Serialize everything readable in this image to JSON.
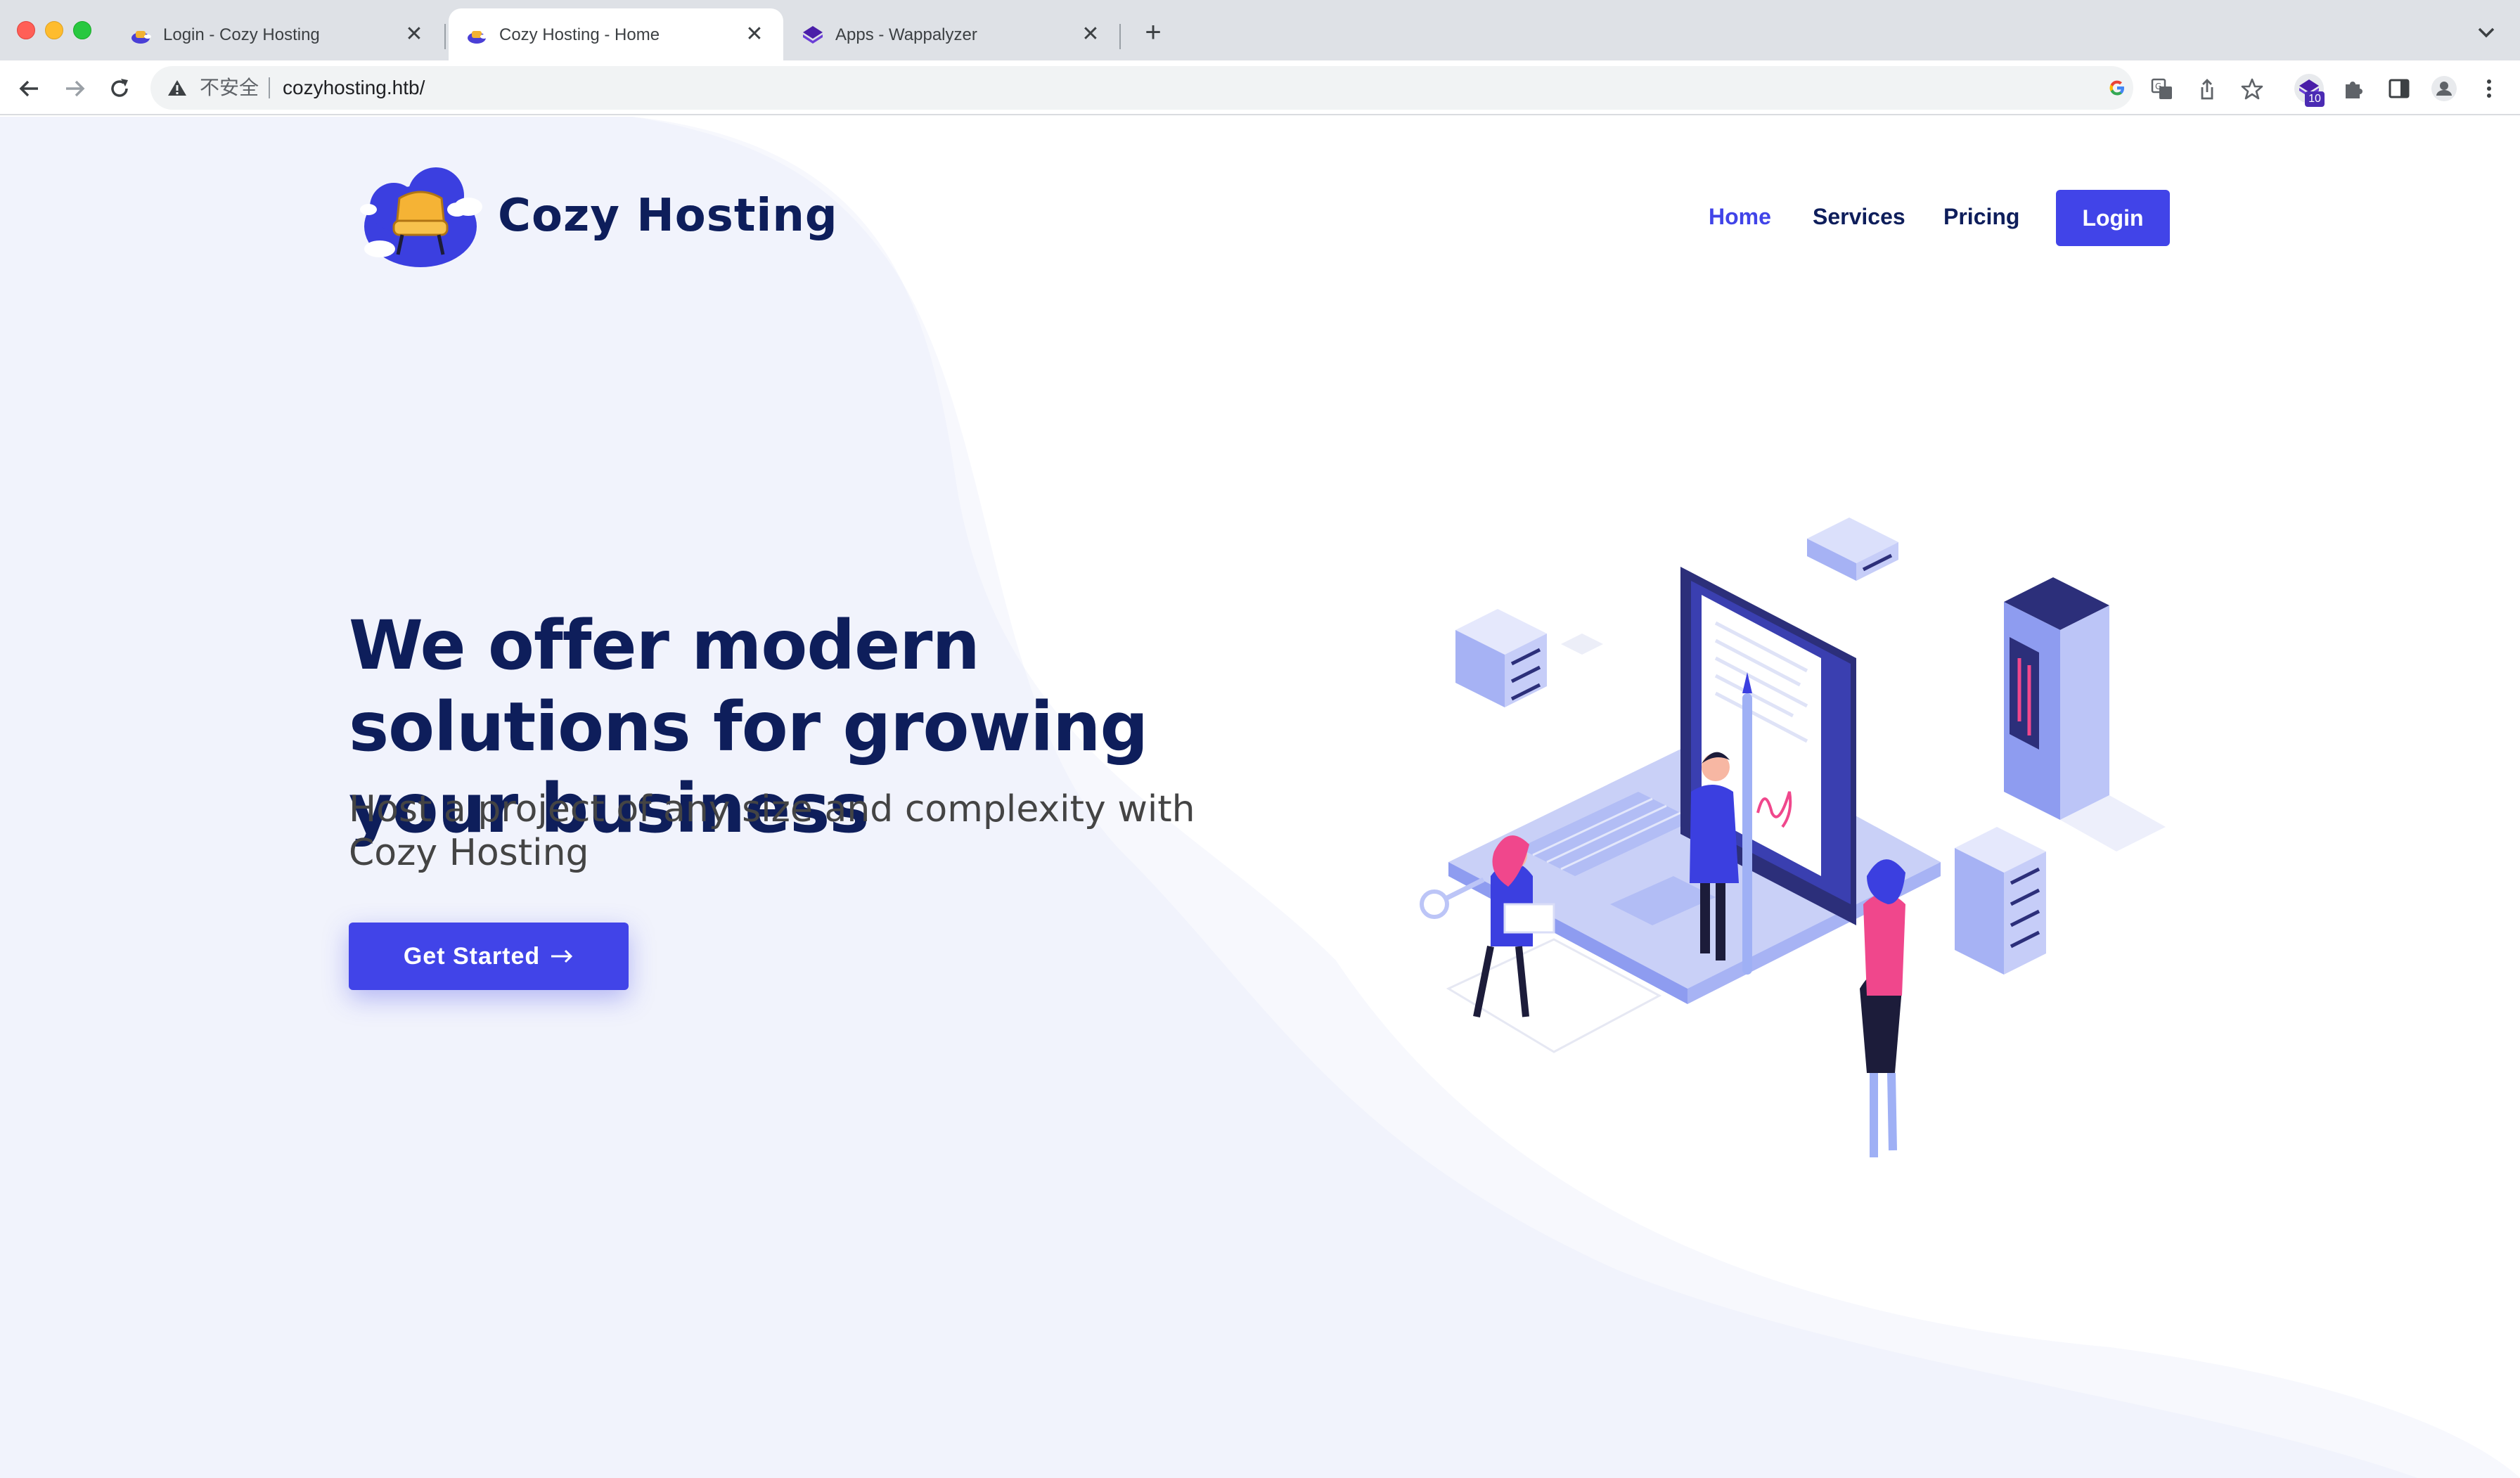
{
  "browser": {
    "tabs": [
      {
        "title": "Login - Cozy Hosting",
        "active": false
      },
      {
        "title": "Cozy Hosting - Home",
        "active": true
      },
      {
        "title": "Apps - Wappalyzer",
        "active": false
      }
    ],
    "new_tab_label": "+",
    "tab_close_glyph": "✕",
    "address": {
      "security_label": "不安全",
      "url": "cozyhosting.htb/"
    },
    "extension_badge": "10"
  },
  "site": {
    "brand_name": "Cozy Hosting",
    "nav": {
      "items": [
        {
          "label": "Home",
          "active": true
        },
        {
          "label": "Services",
          "active": false
        },
        {
          "label": "Pricing",
          "active": false
        }
      ],
      "login_label": "Login"
    },
    "hero": {
      "title": "We offer modern solutions for growing your business",
      "subtitle": "Host a project of any size and complexity with Cozy Hosting",
      "cta_label": "Get Started",
      "cta_icon": "arrow-right-icon"
    },
    "colors": {
      "brand_primary": "#4144e8",
      "heading": "#0e1e5b",
      "background_wave": "#f3f4fc"
    }
  }
}
